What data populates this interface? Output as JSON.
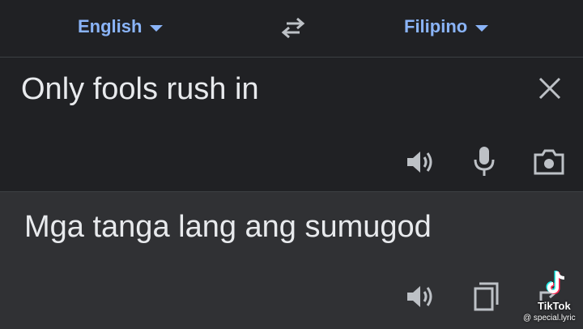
{
  "languages": {
    "source": "English",
    "target": "Filipino"
  },
  "input": {
    "text": "Only fools rush in"
  },
  "output": {
    "text": "Mga tanga lang ang sumugod"
  },
  "icons": {
    "swap": "swap-arrows-icon",
    "clear": "close-icon",
    "speaker": "speaker-icon",
    "mic": "microphone-icon",
    "camera": "camera-icon",
    "copy": "copy-icon",
    "share": "share-icon"
  },
  "colors": {
    "accent": "#8ab4f8",
    "background": "#202124",
    "output_background": "#303134",
    "text": "#e8eaed",
    "icon": "#bdc1c6"
  },
  "watermark": {
    "brand": "TikTok",
    "handle": "@ special.lyric"
  }
}
